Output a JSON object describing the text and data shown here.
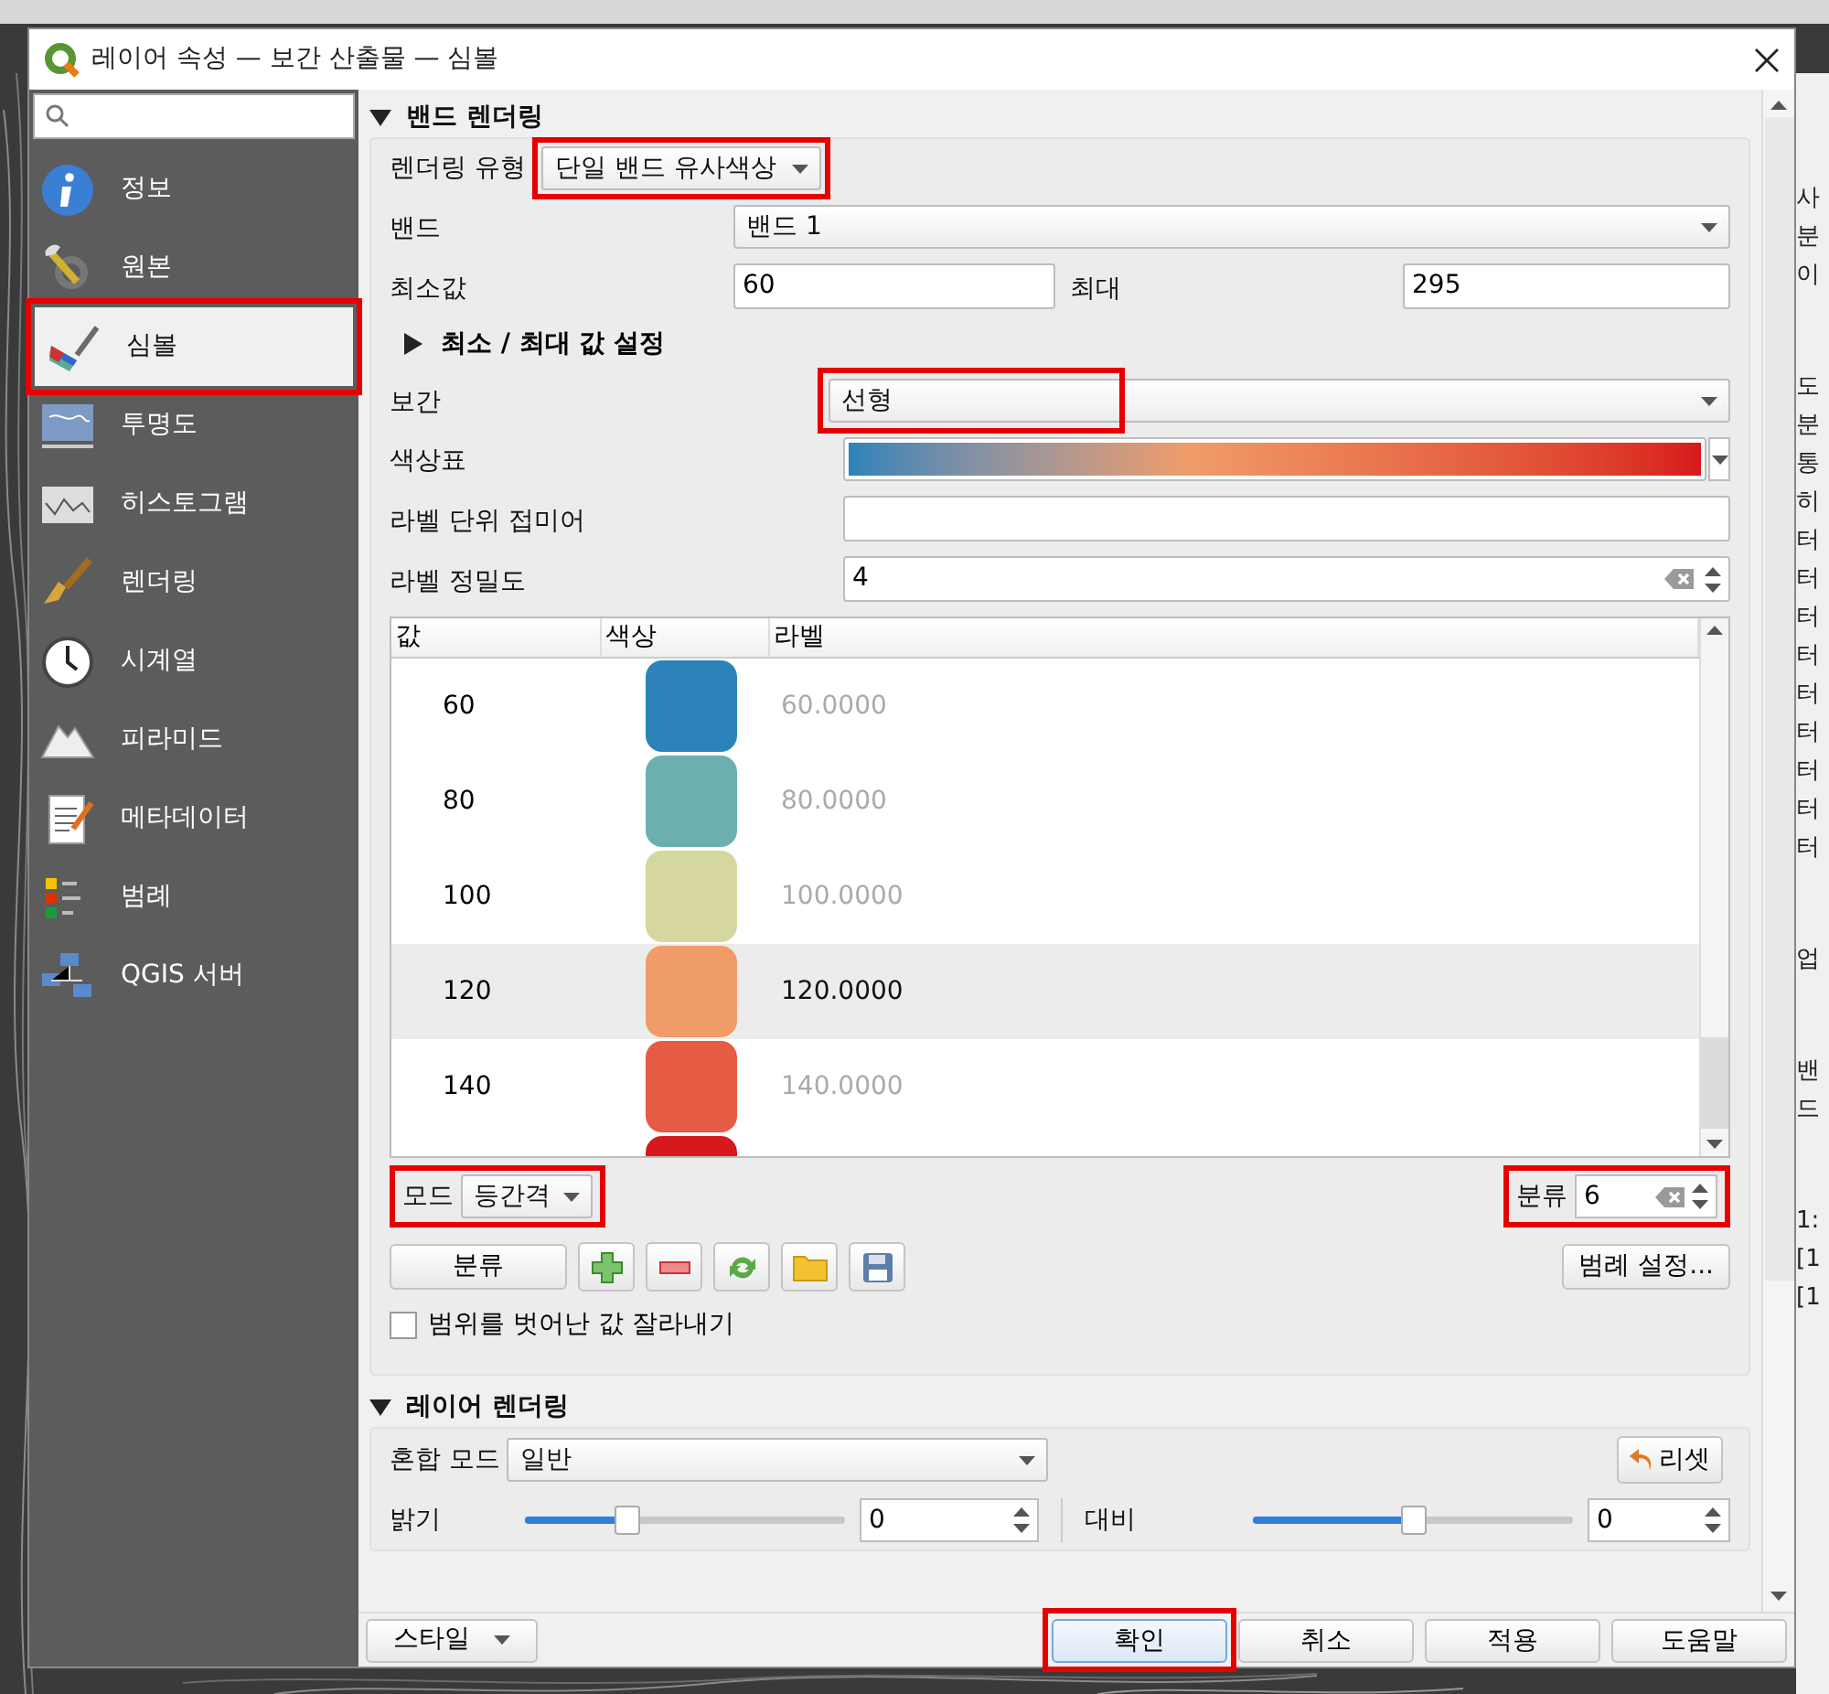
{
  "window": {
    "title": "레이어 속성 — 보간 산출물 — 심볼"
  },
  "sidebar": {
    "items": [
      {
        "label": "정보",
        "selected": false,
        "highlighted": false
      },
      {
        "label": "원본",
        "selected": false,
        "highlighted": false
      },
      {
        "label": "심볼",
        "selected": true,
        "highlighted": true
      },
      {
        "label": "투명도",
        "selected": false,
        "highlighted": false
      },
      {
        "label": "히스토그램",
        "selected": false,
        "highlighted": false
      },
      {
        "label": "렌더링",
        "selected": false,
        "highlighted": false
      },
      {
        "label": "시계열",
        "selected": false,
        "highlighted": false
      },
      {
        "label": "피라미드",
        "selected": false,
        "highlighted": false
      },
      {
        "label": "메타데이터",
        "selected": false,
        "highlighted": false
      },
      {
        "label": "범례",
        "selected": false,
        "highlighted": false
      },
      {
        "label": "QGIS 서버",
        "selected": false,
        "highlighted": false
      }
    ]
  },
  "band_rendering": {
    "title": "밴드 렌더링",
    "expanded": true,
    "render_type": {
      "label": "렌더링 유형",
      "value": "단일 밴드 유사색상",
      "highlighted": true
    },
    "band": {
      "label": "밴드",
      "value": "밴드 1"
    },
    "min": {
      "label": "최소값",
      "value": "60"
    },
    "max": {
      "label": "최대",
      "value": "295"
    },
    "minmax_settings": {
      "label": "최소 / 최대 값 설정",
      "expanded": false
    },
    "interpolation": {
      "label": "보간",
      "value": "선형",
      "highlighted": true
    },
    "color_ramp": {
      "label": "색상표"
    },
    "label_suffix": {
      "label": "라벨 단위 접미어"
    },
    "label_precision": {
      "label": "라벨 정밀도",
      "value": "4"
    },
    "table": {
      "columns": [
        "값",
        "색상",
        "라벨"
      ],
      "rows": [
        {
          "value": "60",
          "color": "#2b83ba",
          "label": "60.0000",
          "selected": false
        },
        {
          "value": "80",
          "color": "#6bb0af",
          "label": "80.0000",
          "selected": false
        },
        {
          "value": "100",
          "color": "#d5d79f",
          "label": "100.0000",
          "selected": false
        },
        {
          "value": "120",
          "color": "#f09c68",
          "label": "120.0000",
          "selected": true
        },
        {
          "value": "140",
          "color": "#e55b43",
          "label": "140.0000",
          "selected": false
        },
        {
          "color": "#d7191c",
          "selected": false
        }
      ]
    },
    "mode": {
      "label": "모드",
      "value": "등간격",
      "highlighted": true
    },
    "classes": {
      "label": "분류",
      "value": "6",
      "highlighted": true
    },
    "classify_button": "분류",
    "legend_button": "범례 설정...",
    "clip": {
      "label": "범위를 벗어난 값 잘라내기",
      "checked": false
    }
  },
  "layer_rendering": {
    "title": "레이어 렌더링",
    "expanded": true,
    "blend_mode": {
      "label": "혼합 모드",
      "value": "일반"
    },
    "reset_button": "리셋",
    "brightness": {
      "label": "밝기",
      "level": 0.32,
      "value": "0"
    },
    "contrast": {
      "label": "대비",
      "level": 0.5,
      "value": "0"
    }
  },
  "footer": {
    "style_button": "스타일",
    "buttons": [
      {
        "label": "확인",
        "highlighted": true,
        "focused": true
      },
      {
        "label": "취소",
        "highlighted": false,
        "focused": false
      },
      {
        "label": "적용",
        "highlighted": false,
        "focused": false
      },
      {
        "label": "도움말",
        "highlighted": false,
        "focused": false
      }
    ]
  },
  "background_panel": {
    "text_groups": [
      [
        "사",
        "분",
        "이"
      ],
      [
        "도",
        "분",
        "통",
        "히",
        "터",
        "터",
        "터",
        "터",
        "터",
        "터",
        "터",
        "터",
        "터"
      ],
      [
        "업"
      ],
      [
        "밴",
        "드"
      ],
      [
        "1:",
        "[1",
        "[1"
      ]
    ]
  }
}
